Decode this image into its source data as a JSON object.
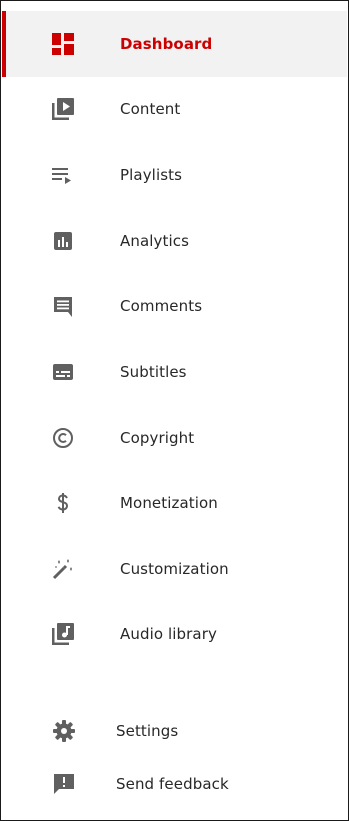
{
  "colors": {
    "accent": "#cc0000",
    "icon": "#606060",
    "text": "#282828",
    "active_bg": "#f2f2f2"
  },
  "nav": {
    "items": [
      {
        "label": "Dashboard",
        "icon": "dashboard-icon",
        "active": true
      },
      {
        "label": "Content",
        "icon": "content-icon"
      },
      {
        "label": "Playlists",
        "icon": "playlists-icon"
      },
      {
        "label": "Analytics",
        "icon": "analytics-icon"
      },
      {
        "label": "Comments",
        "icon": "comments-icon"
      },
      {
        "label": "Subtitles",
        "icon": "subtitles-icon"
      },
      {
        "label": "Copyright",
        "icon": "copyright-icon"
      },
      {
        "label": "Monetization",
        "icon": "monetization-icon"
      },
      {
        "label": "Customization",
        "icon": "customization-icon"
      },
      {
        "label": "Audio library",
        "icon": "audio-library-icon"
      }
    ]
  },
  "footer": {
    "items": [
      {
        "label": "Settings",
        "icon": "gear-icon"
      },
      {
        "label": "Send feedback",
        "icon": "feedback-icon"
      }
    ]
  }
}
